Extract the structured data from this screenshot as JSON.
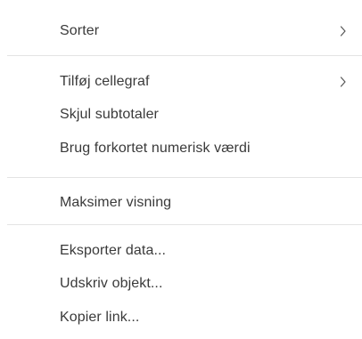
{
  "menu": {
    "items": [
      {
        "id": "sort",
        "label": "Sorter",
        "submenu": true
      },
      {
        "id": "add-cell-chart",
        "label": "Tilføj cellegraf",
        "submenu": true
      },
      {
        "id": "hide-subtotals",
        "label": "Skjul subtotaler",
        "submenu": false
      },
      {
        "id": "abbreviated-numeric",
        "label": "Brug forkortet numerisk værdi",
        "submenu": false
      },
      {
        "id": "maximize-view",
        "label": "Maksimer visning",
        "submenu": false
      },
      {
        "id": "export-data",
        "label": "Eksporter data...",
        "submenu": false
      },
      {
        "id": "print-object",
        "label": "Udskriv objekt...",
        "submenu": false
      },
      {
        "id": "copy-link",
        "label": "Kopier link...",
        "submenu": false
      }
    ]
  },
  "icons": {
    "submenu_arrow": "chevron-right-icon"
  },
  "colors": {
    "text": "#3a3a3a",
    "divider": "#e3e3e3",
    "background": "#ffffff"
  }
}
